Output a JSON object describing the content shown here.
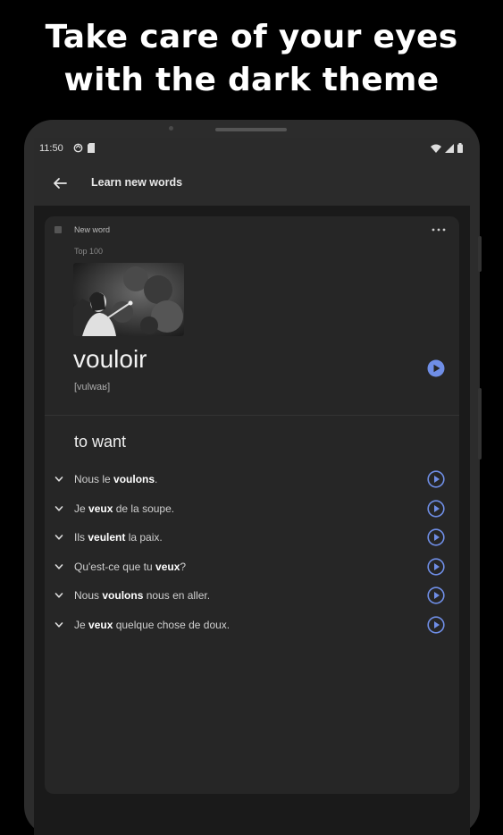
{
  "promo": {
    "line1": "Take care of your eyes",
    "line2": "with the dark theme"
  },
  "status_bar": {
    "time": "11:50",
    "left_icons": [
      "sync-icon",
      "sd-card-icon"
    ],
    "right_icons": [
      "wifi-icon",
      "signal-icon",
      "battery-icon"
    ]
  },
  "app_bar": {
    "title": "Learn new words",
    "back_icon": "arrow-back-icon"
  },
  "card": {
    "new_word_label": "New word",
    "more_icon": "more-horizontal-icon",
    "list_label": "Top 100",
    "word": "vouloir",
    "ipa": "[vulwaʁ]",
    "translation": "to want",
    "accent_color": "#6f8ee6",
    "examples": [
      {
        "pre": "Nous le ",
        "bold": "voulons",
        "post": "."
      },
      {
        "pre": "Je ",
        "bold": "veux",
        "post": " de la soupe."
      },
      {
        "pre": "Ils ",
        "bold": "veulent",
        "post": " la paix."
      },
      {
        "pre": "Qu'est-ce que tu ",
        "bold": "veux",
        "post": "?"
      },
      {
        "pre": "Nous ",
        "bold": "voulons",
        "post": " nous en aller."
      },
      {
        "pre": "Je ",
        "bold": "veux",
        "post": " quelque chose de doux."
      }
    ]
  }
}
